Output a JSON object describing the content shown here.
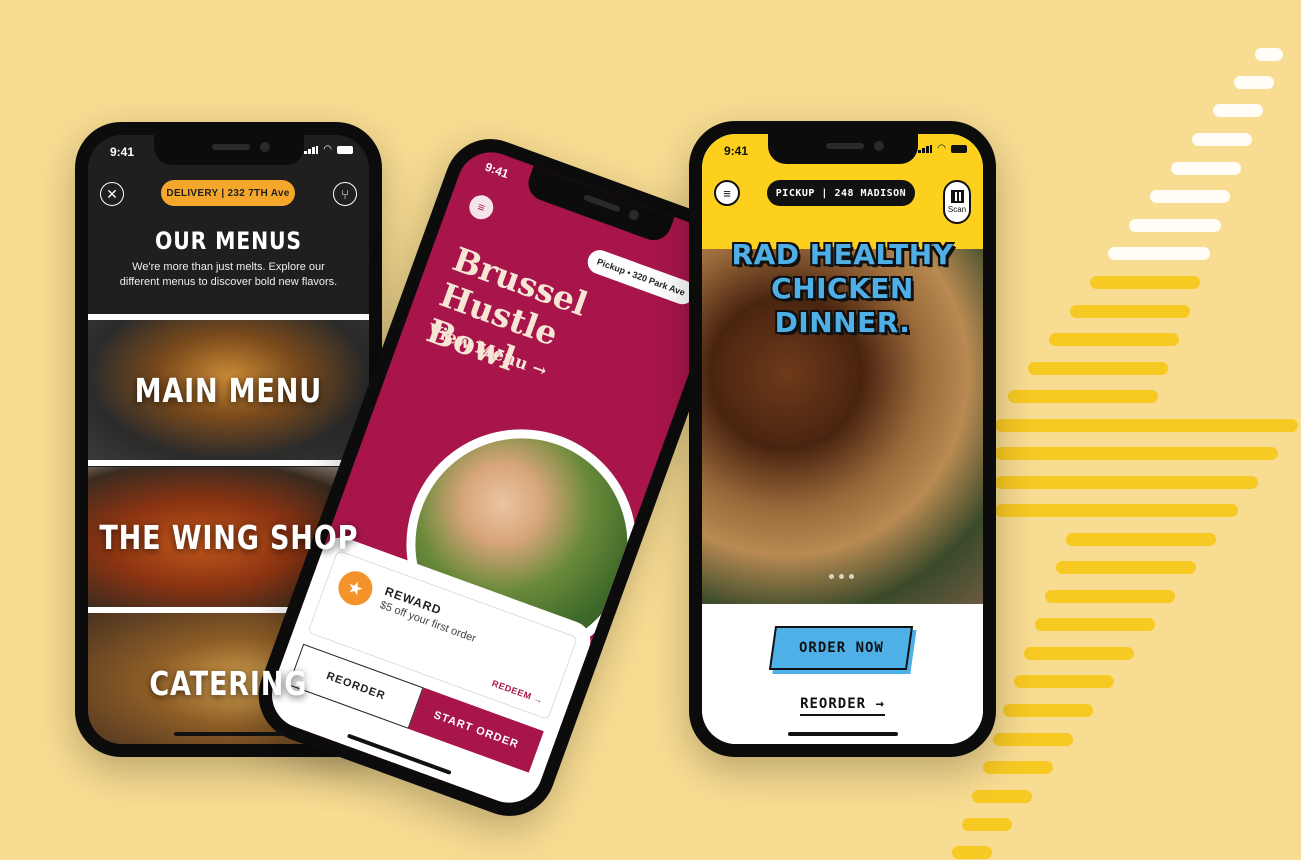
{
  "status_bar": {
    "time": "9:41"
  },
  "phone1": {
    "pill": "DELIVERY | 232 7TH Ave",
    "title": "OUR MENUS",
    "description": "We're more than just melts. Explore our different menus to discover bold new flavors.",
    "tiles": [
      "MAIN MENU",
      "THE WING SHOP",
      "CATERING"
    ]
  },
  "phone2": {
    "pill": "Pickup • 320 Park Ave",
    "title": "Brussel Hustle Bowl",
    "view_menu": "View Menu →",
    "reward_title": "REWARD",
    "reward_desc": "$5 off your first order",
    "redeem": "REDEEM →",
    "reorder": "REORDER",
    "start_order": "START ORDER"
  },
  "phone3": {
    "pill": "PICKUP | 248 MADISON",
    "scan": "Scan",
    "headline_line1": "RAD HEALTHY",
    "headline_line2": "CHICKEN DINNER.",
    "order_now": "ORDER NOW",
    "reorder": "REORDER →"
  },
  "colors": {
    "background": "#f8dc92",
    "accent_orange": "#f4a72b",
    "brand_magenta": "#a8154a",
    "brand_yellow": "#fcd01c",
    "brand_blue": "#4fb0e8"
  },
  "icons": [
    "close-icon",
    "utensils-icon",
    "menu-icon",
    "star-icon",
    "qr-icon"
  ]
}
